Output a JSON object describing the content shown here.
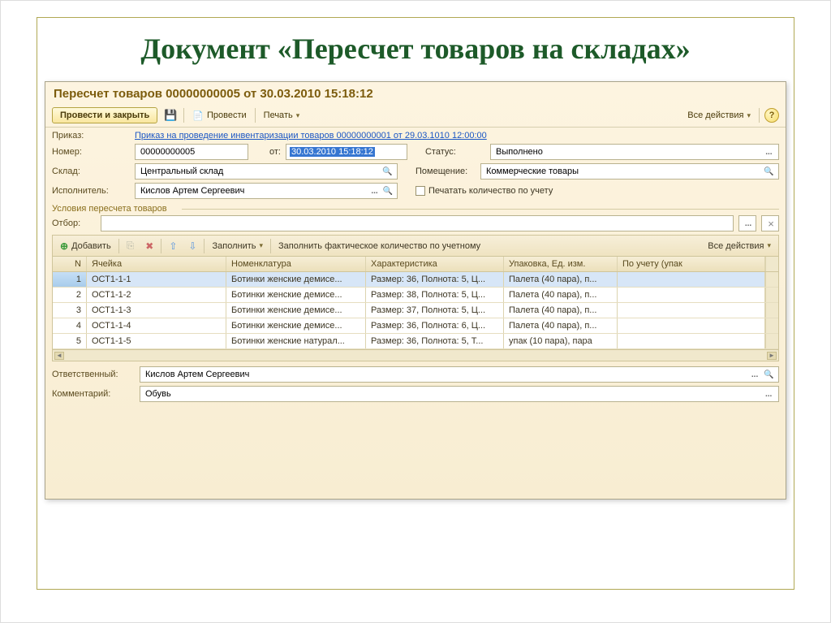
{
  "slide_title": "Документ «Пересчет товаров на складах»",
  "window": {
    "title": "Пересчет товаров 00000000005 от 30.03.2010 15:18:12",
    "toolbar": {
      "post_close": "Провести и закрыть",
      "post": "Провести",
      "print": "Печать",
      "all_actions": "Все действия"
    },
    "form": {
      "order_label": "Приказ:",
      "order_link": "Приказ на проведение инвентаризации товаров 00000000001 от 29.03.1010 12:00:00",
      "number_label": "Номер:",
      "number_value": "00000000005",
      "from_label": "от:",
      "date_value": "30.03.2010 15:18:12",
      "status_label": "Статус:",
      "status_value": "Выполнено",
      "warehouse_label": "Склад:",
      "warehouse_value": "Центральный склад",
      "room_label": "Помещение:",
      "room_value": "Коммерческие товары",
      "executor_label": "Исполнитель:",
      "executor_value": "Кислов Артем Сергеевич",
      "print_qty_label": "Печатать количество по учету"
    },
    "section_conditions": "Условия пересчета товаров",
    "filter_label": "Отбор:",
    "table_toolbar": {
      "add": "Добавить",
      "fill": "Заполнить",
      "fill_fact": "Заполнить фактическое количество по учетному",
      "all_actions": "Все действия"
    },
    "columns": {
      "n": "N",
      "cell": "Ячейка",
      "nomenclature": "Номенклатура",
      "characteristic": "Характеристика",
      "packaging": "Упаковка, Ед. изм.",
      "by_account": "По учету (упак"
    },
    "rows": [
      {
        "n": "1",
        "cell": "ОСТ1-1-1",
        "nom": "Ботинки женские демисе...",
        "char": "Размер: 36, Полнота: 5, Ц...",
        "pack": "Палета (40 пара), п..."
      },
      {
        "n": "2",
        "cell": "ОСТ1-1-2",
        "nom": "Ботинки женские демисе...",
        "char": "Размер: 38, Полнота: 5, Ц...",
        "pack": "Палета (40 пара), п..."
      },
      {
        "n": "3",
        "cell": "ОСТ1-1-3",
        "nom": "Ботинки женские демисе...",
        "char": "Размер: 37, Полнота: 5, Ц...",
        "pack": "Палета (40 пара), п..."
      },
      {
        "n": "4",
        "cell": "ОСТ1-1-4",
        "nom": "Ботинки женские демисе...",
        "char": "Размер: 36, Полнота: 6, Ц...",
        "pack": "Палета (40 пара), п..."
      },
      {
        "n": "5",
        "cell": "ОСТ1-1-5",
        "nom": "Ботинки женские натурал...",
        "char": "Размер: 36, Полнота: 5, Т...",
        "pack": "упак (10 пара), пара"
      }
    ],
    "bottom": {
      "responsible_label": "Ответственный:",
      "responsible_value": "Кислов Артем Сергеевич",
      "comment_label": "Комментарий:",
      "comment_value": "Обувь"
    }
  }
}
